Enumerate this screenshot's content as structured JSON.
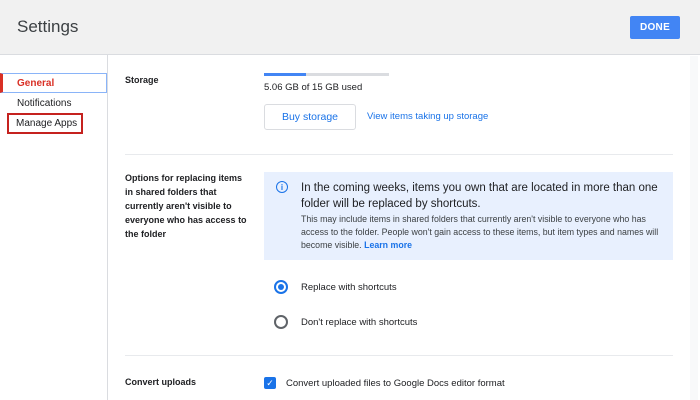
{
  "header": {
    "title": "Settings",
    "done_label": "DONE"
  },
  "sidebar": {
    "items": [
      {
        "label": "General",
        "selected": true
      },
      {
        "label": "Notifications",
        "selected": false
      },
      {
        "label": "Manage Apps",
        "selected": false,
        "highlighted": true
      }
    ]
  },
  "storage": {
    "label": "Storage",
    "usage_text": "5.06 GB of 15 GB used",
    "usage_fraction": 0.337,
    "buy_label": "Buy storage",
    "view_label": "View items taking up storage"
  },
  "options": {
    "label": "Options for replacing items in shared folders that currently aren't visible to everyone who has access to the folder",
    "info": {
      "icon": "info-icon",
      "heading": "In the coming weeks, items you own that are located in more than one folder will be replaced by shortcuts.",
      "body": "This may include items in shared folders that currently aren't visible to everyone who has access to the folder. People won't gain access to these items, but item types and names will become visible.",
      "learn_more": "Learn more"
    },
    "radios": [
      {
        "label": "Replace with shortcuts",
        "checked": true
      },
      {
        "label": "Don't replace with shortcuts",
        "checked": false
      }
    ]
  },
  "convert": {
    "label": "Convert uploads",
    "checkbox_label": "Convert uploaded files to Google Docs editor format",
    "checked": true
  },
  "colors": {
    "accent": "#1a73e8",
    "done_button": "#4285f4",
    "selected_nav": "#d93025",
    "highlight_box": "#c5221f",
    "info_background": "#e8f0fe"
  }
}
